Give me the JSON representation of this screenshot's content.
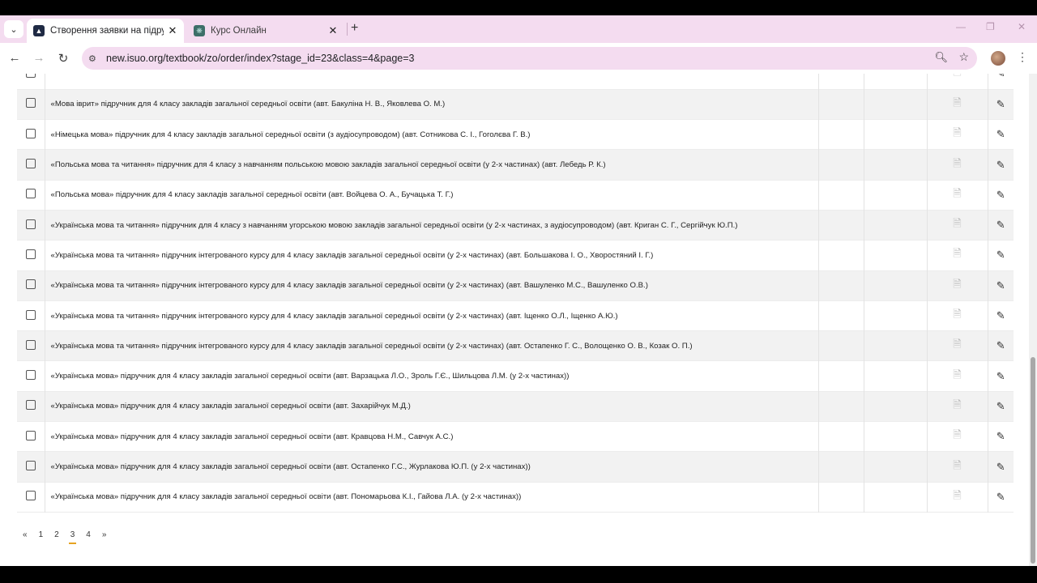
{
  "browser": {
    "tabs": [
      {
        "title": "Створення заявки на підручник",
        "icon": "graduation-cap-icon",
        "active": true
      },
      {
        "title": "Курс Онлайн",
        "icon": "openai-icon",
        "active": false
      }
    ],
    "new_tab_label": "+",
    "url": "new.isuo.org/textbook/zo/order/index?stage_id=23&class=4&page=3"
  },
  "table": {
    "rows": [
      {
        "name": ""
      },
      {
        "name": "«Мова іврит» підручник для 4 класу закладів загальної середньої освіти (авт. Бакуліна Н. В., Яковлева О. М.)"
      },
      {
        "name": "«Німецька мова» підручник для 4 класу закладів загальної середньої освіти (з аудіосупроводом) (авт. Сотникова С. І., Гоголєва Г. В.)"
      },
      {
        "name": "«Польська мова та читання» підручник для 4 класу з навчанням польською мовою закладів загальної середньої освіти (у 2-х частинах) (авт. Лебедь Р. К.)"
      },
      {
        "name": "«Польська мова» підручник для 4 класу закладів загальної середньої освіти (авт. Войцева О. А., Бучацька Т. Г.)"
      },
      {
        "name": "«Українська мова та читання» підручник для 4 класу з навчанням угорською мовою закладів загальної середньої освіти (у 2-х частинах, з аудіосупроводом) (авт. Криган С. Г., Сергійчук Ю.П.)"
      },
      {
        "name": "«Українська мова та читання» підручник інтегрованого курсу для 4 класу закладів загальної середньої освіти (у 2-х частинах) (авт. Большакова І. О., Хворостяний І. Г.)"
      },
      {
        "name": "«Українська мова та читання» підручник інтегрованого курсу для 4 класу закладів загальної середньої освіти (у 2-х частинах) (авт. Вашуленко М.С., Вашуленко О.В.)"
      },
      {
        "name": "«Українська мова та читання» підручник інтегрованого курсу для 4 класу закладів загальної середньої освіти (у 2-х частинах) (авт. Іщенко О.Л., Іщенко А.Ю.)"
      },
      {
        "name": "«Українська мова та читання» підручник інтегрованого курсу для 4 класу закладів загальної середньої освіти (у 2-х частинах) (авт. Остапенко Г. С., Волощенко О. В., Козак О. П.)"
      },
      {
        "name": "«Українська мова» підручник для 4 класу закладів загальної середньої освіти (авт. Варзацька Л.О., Зроль Г.Є., Шильцова Л.М. (у 2-х частинах))"
      },
      {
        "name": "«Українська мова» підручник для 4 класу закладів загальної середньої освіти (авт. Захарійчук М.Д.)"
      },
      {
        "name": "«Українська мова» підручник для 4 класу закладів загальної середньої освіти (авт. Кравцова Н.М., Савчук А.С.)"
      },
      {
        "name": "«Українська мова» підручник для 4 класу закладів загальної середньої освіти (авт. Остапенко Г.С., Журлакова Ю.П. (у 2-х частинах))"
      },
      {
        "name": "«Українська мова» підручник для 4 класу закладів загальної середньої освіти (авт. Пономарьова К.І., Гайова Л.А. (у 2-х частинах))"
      }
    ]
  },
  "pagination": {
    "prev": "«",
    "pages": [
      "1",
      "2",
      "3",
      "4"
    ],
    "current": "3",
    "next": "»"
  }
}
